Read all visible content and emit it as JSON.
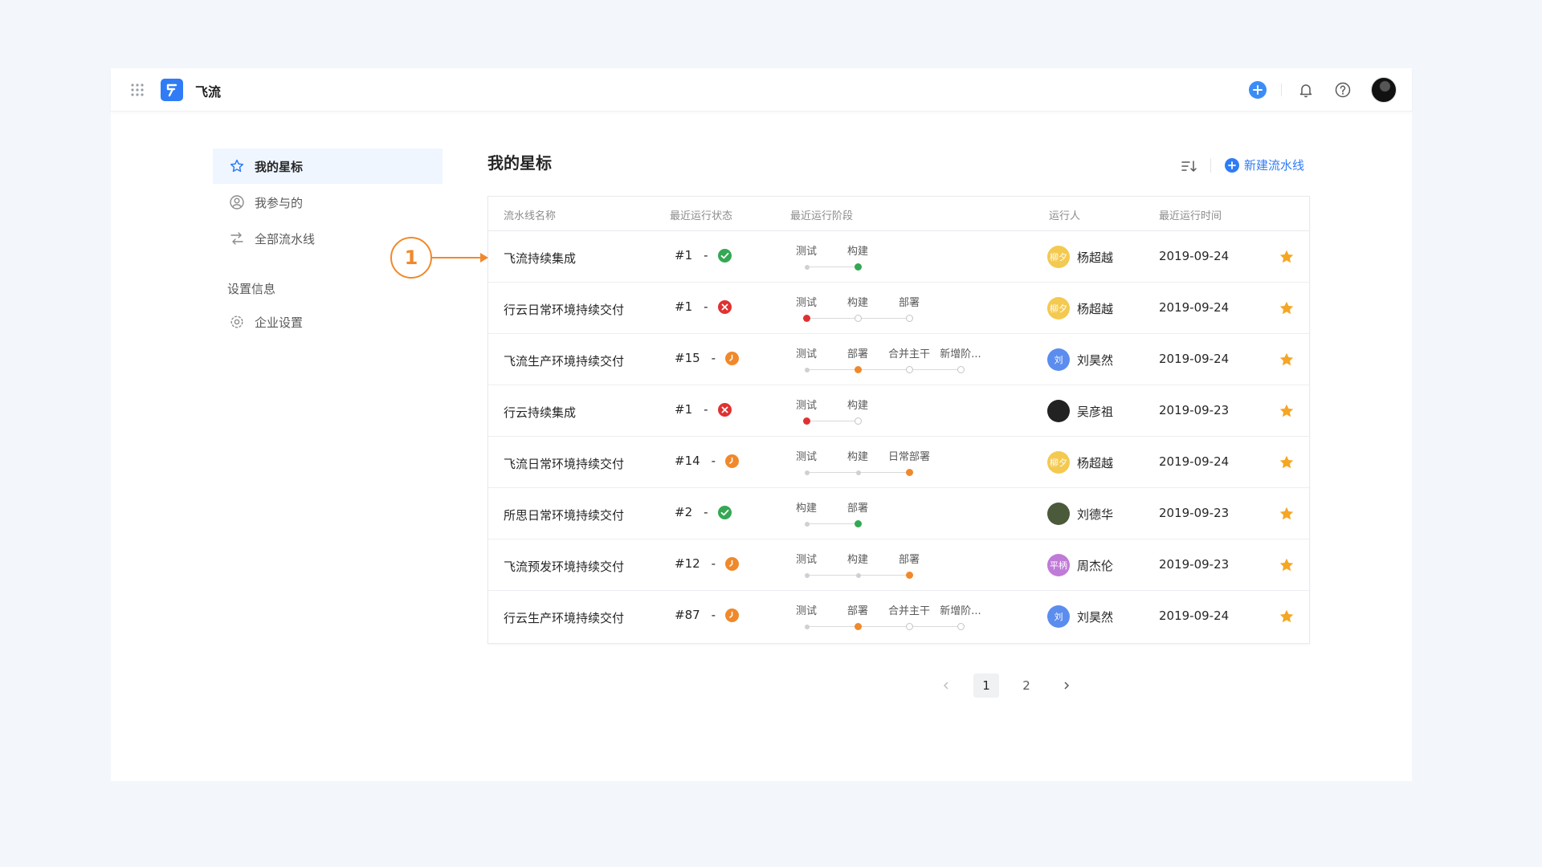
{
  "header": {
    "app_title": "飞流"
  },
  "sidebar": {
    "items": [
      {
        "label": "我的星标",
        "icon": "star-icon",
        "active": true
      },
      {
        "label": "我参与的",
        "icon": "user-circle-icon",
        "active": false
      },
      {
        "label": "全部流水线",
        "icon": "pipeline-icon",
        "active": false
      }
    ],
    "section_title": "设置信息",
    "settings_items": [
      {
        "label": "企业设置",
        "icon": "gear-icon"
      }
    ]
  },
  "main": {
    "title": "我的星标",
    "new_button_label": "新建流水线",
    "columns": [
      "流水线名称",
      "最近运行状态",
      "最近运行阶段",
      "运行人",
      "最近运行时间"
    ],
    "rows": [
      {
        "name": "飞流持续集成",
        "run": "#1",
        "dash": "-",
        "status": "success",
        "stages": [
          "测试",
          "构建"
        ],
        "stage_states": [
          "done",
          "success"
        ],
        "user": "杨超越",
        "avatar_text": "柳夕",
        "avatar_color": "#f3c94f",
        "time": "2019-09-24"
      },
      {
        "name": "行云日常环境持续交付",
        "run": "#1",
        "dash": "-",
        "status": "fail",
        "stages": [
          "测试",
          "构建",
          "部署"
        ],
        "stage_states": [
          "fail",
          "pending",
          "pending"
        ],
        "user": "杨超越",
        "avatar_text": "柳夕",
        "avatar_color": "#f3c94f",
        "time": "2019-09-24"
      },
      {
        "name": "飞流生产环境持续交付",
        "run": "#15",
        "dash": "-",
        "status": "running",
        "stages": [
          "测试",
          "部署",
          "合并主干",
          "新增阶..."
        ],
        "stage_states": [
          "done",
          "running",
          "pending",
          "pending"
        ],
        "user": "刘昊然",
        "avatar_text": "刘",
        "avatar_color": "#5b8def",
        "time": "2019-09-24"
      },
      {
        "name": "行云持续集成",
        "run": "#1",
        "dash": "-",
        "status": "fail",
        "stages": [
          "测试",
          "构建"
        ],
        "stage_states": [
          "fail",
          "pending"
        ],
        "user": "吴彦祖",
        "avatar_text": "",
        "avatar_color": "#222222",
        "time": "2019-09-23"
      },
      {
        "name": "飞流日常环境持续交付",
        "run": "#14",
        "dash": "-",
        "status": "running",
        "stages": [
          "测试",
          "构建",
          "日常部署"
        ],
        "stage_states": [
          "done",
          "done",
          "running"
        ],
        "user": "杨超越",
        "avatar_text": "柳夕",
        "avatar_color": "#f3c94f",
        "time": "2019-09-24"
      },
      {
        "name": "所思日常环境持续交付",
        "run": "#2",
        "dash": "-",
        "status": "success",
        "stages": [
          "构建",
          "部署"
        ],
        "stage_states": [
          "done",
          "success"
        ],
        "user": "刘德华",
        "avatar_text": "",
        "avatar_color": "#4a5a3a",
        "time": "2019-09-23"
      },
      {
        "name": "飞流预发环境持续交付",
        "run": "#12",
        "dash": "-",
        "status": "running",
        "stages": [
          "测试",
          "构建",
          "部署"
        ],
        "stage_states": [
          "done",
          "done",
          "running"
        ],
        "user": "周杰伦",
        "avatar_text": "平柄",
        "avatar_color": "#c07ad8",
        "time": "2019-09-23"
      },
      {
        "name": "行云生产环境持续交付",
        "run": "#87",
        "dash": "-",
        "status": "running",
        "stages": [
          "测试",
          "部署",
          "合并主干",
          "新增阶..."
        ],
        "stage_states": [
          "done",
          "running",
          "pending",
          "pending"
        ],
        "user": "刘昊然",
        "avatar_text": "刘",
        "avatar_color": "#5b8def",
        "time": "2019-09-24"
      }
    ]
  },
  "pagination": {
    "pages": [
      "1",
      "2"
    ],
    "current": "1"
  },
  "annotation": {
    "label": "1"
  },
  "colors": {
    "accent": "#2f7cf6",
    "success": "#34a853",
    "fail": "#e03131",
    "running": "#f0892b",
    "star": "#f5a623"
  }
}
